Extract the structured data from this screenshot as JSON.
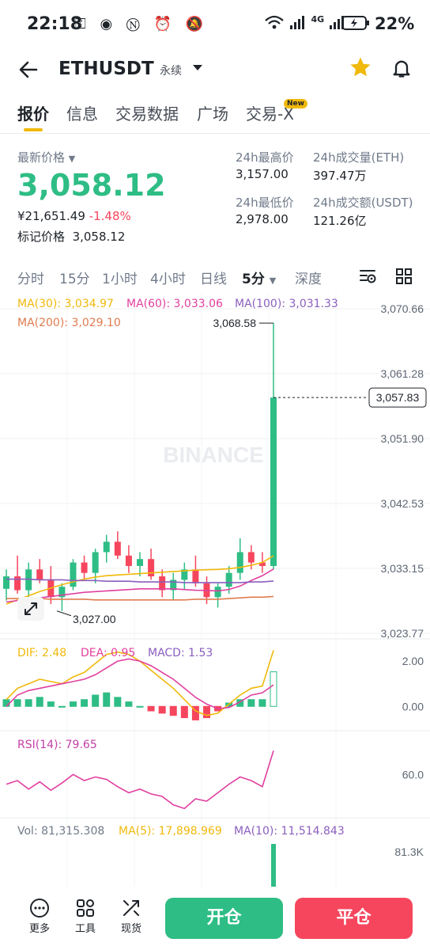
{
  "status_bar": {
    "time": "22:18",
    "icons": [
      "key-icon",
      "eye-icon",
      "nfc-icon",
      "alarm-icon",
      "mute-icon"
    ],
    "network": "4G",
    "wifi_tag": "6",
    "battery_pct": "22%"
  },
  "header": {
    "symbol": "ETHUSDT",
    "contract_type": "永续",
    "favorite": true
  },
  "tabs": [
    {
      "label": "报价",
      "active": true
    },
    {
      "label": "信息"
    },
    {
      "label": "交易数据"
    },
    {
      "label": "广场"
    },
    {
      "label": "交易-X",
      "badge": "New"
    }
  ],
  "price": {
    "last_label": "最新价格",
    "last": "3,058.12",
    "cny": "¥21,651.49",
    "change": "-1.48%",
    "mark_label": "标记价格",
    "mark": "3,058.12",
    "high_label": "24h最高价",
    "high": "3,157.00",
    "low_label": "24h最低价",
    "low": "2,978.00",
    "vol_label": "24h成交量(ETH)",
    "vol": "397.47万",
    "turnover_label": "24h成交额(USDT)",
    "turnover": "121.26亿"
  },
  "timeframes": [
    {
      "label": "分时"
    },
    {
      "label": "15分"
    },
    {
      "label": "1小时"
    },
    {
      "label": "4小时"
    },
    {
      "label": "日线"
    },
    {
      "label": "5分",
      "active": true
    },
    {
      "label": "深度"
    }
  ],
  "chart_data": {
    "type": "candlestick",
    "interval": "5分",
    "watermark": "BINANCE",
    "y_ticks": [
      "3,070.66",
      "3,061.28",
      "3,051.90",
      "3,042.53",
      "3,033.15",
      "3,023.77"
    ],
    "ylim": [
      3023.77,
      3070.66
    ],
    "current_price_tag": "3,057.83",
    "high_label": "3,068.58",
    "low_label": "3,027.00",
    "ma_legend": {
      "ma30": "MA(30): 3,034.97",
      "ma60": "MA(60): 3,033.06",
      "ma100": "MA(100): 3,031.33",
      "ma200": "MA(200): 3,029.10"
    },
    "colors": {
      "up": "#2ebd85",
      "down": "#f6465d",
      "ma30": "#f0b90b",
      "ma60": "#e0409f",
      "ma100": "#8b5fbf",
      "ma200": "#e07b4f"
    },
    "candles": [
      {
        "o": 3030.2,
        "h": 3033.0,
        "l": 3028.5,
        "c": 3032.0
      },
      {
        "o": 3032.0,
        "h": 3035.0,
        "l": 3029.5,
        "c": 3030.0
      },
      {
        "o": 3030.0,
        "h": 3034.0,
        "l": 3029.0,
        "c": 3033.0
      },
      {
        "o": 3033.0,
        "h": 3034.5,
        "l": 3031.0,
        "c": 3031.5
      },
      {
        "o": 3031.5,
        "h": 3033.5,
        "l": 3028.0,
        "c": 3029.0
      },
      {
        "o": 3029.0,
        "h": 3031.0,
        "l": 3027.0,
        "c": 3030.5
      },
      {
        "o": 3030.5,
        "h": 3034.5,
        "l": 3030.0,
        "c": 3034.0
      },
      {
        "o": 3034.0,
        "h": 3035.0,
        "l": 3031.5,
        "c": 3032.5
      },
      {
        "o": 3032.5,
        "h": 3036.0,
        "l": 3031.0,
        "c": 3035.5
      },
      {
        "o": 3035.5,
        "h": 3038.0,
        "l": 3034.0,
        "c": 3037.0
      },
      {
        "o": 3037.0,
        "h": 3038.5,
        "l": 3034.5,
        "c": 3035.0
      },
      {
        "o": 3035.0,
        "h": 3036.5,
        "l": 3032.5,
        "c": 3033.5
      },
      {
        "o": 3033.5,
        "h": 3035.5,
        "l": 3032.0,
        "c": 3034.5
      },
      {
        "o": 3034.5,
        "h": 3036.0,
        "l": 3031.5,
        "c": 3032.0
      },
      {
        "o": 3032.0,
        "h": 3033.0,
        "l": 3029.0,
        "c": 3030.0
      },
      {
        "o": 3030.0,
        "h": 3032.5,
        "l": 3028.5,
        "c": 3031.5
      },
      {
        "o": 3031.5,
        "h": 3034.0,
        "l": 3030.0,
        "c": 3033.0
      },
      {
        "o": 3033.0,
        "h": 3035.0,
        "l": 3030.5,
        "c": 3031.0
      },
      {
        "o": 3031.0,
        "h": 3032.0,
        "l": 3028.0,
        "c": 3029.0
      },
      {
        "o": 3029.0,
        "h": 3031.0,
        "l": 3027.5,
        "c": 3030.5
      },
      {
        "o": 3030.5,
        "h": 3033.5,
        "l": 3029.5,
        "c": 3032.5
      },
      {
        "o": 3032.5,
        "h": 3037.5,
        "l": 3031.5,
        "c": 3035.5
      },
      {
        "o": 3035.5,
        "h": 3036.5,
        "l": 3033.0,
        "c": 3034.0
      },
      {
        "o": 3034.0,
        "h": 3035.5,
        "l": 3032.5,
        "c": 3033.5
      },
      {
        "o": 3033.5,
        "h": 3068.58,
        "l": 3033.0,
        "c": 3057.83
      }
    ],
    "ma30": [
      3028.0,
      3028.6,
      3029.2,
      3029.8,
      3030.3,
      3030.8,
      3031.2,
      3031.6,
      3031.9,
      3032.1,
      3032.2,
      3032.3,
      3032.4,
      3032.5,
      3032.6,
      3032.7,
      3032.8,
      3032.9,
      3032.95,
      3033.0,
      3033.1,
      3033.3,
      3033.6,
      3034.0,
      3034.97
    ],
    "ma60": [
      3028.3,
      3028.5,
      3028.7,
      3028.9,
      3029.1,
      3029.3,
      3029.5,
      3029.7,
      3029.8,
      3029.9,
      3030.0,
      3030.1,
      3030.2,
      3030.2,
      3030.2,
      3030.2,
      3030.1,
      3030.0,
      3029.95,
      3029.9,
      3030.1,
      3030.6,
      3031.4,
      3032.1,
      3033.06
    ],
    "ma100": [
      3031.6,
      3031.6,
      3031.6,
      3031.5,
      3031.5,
      3031.5,
      3031.4,
      3031.4,
      3031.4,
      3031.3,
      3031.3,
      3031.3,
      3031.2,
      3031.2,
      3031.2,
      3031.2,
      3031.1,
      3031.1,
      3031.1,
      3031.1,
      3031.1,
      3031.1,
      3031.2,
      3031.2,
      3031.33
    ],
    "ma200": [
      3028.8,
      3028.8,
      3028.8,
      3028.8,
      3028.7,
      3028.7,
      3028.7,
      3028.7,
      3028.6,
      3028.6,
      3028.6,
      3028.6,
      3028.6,
      3028.6,
      3028.6,
      3028.6,
      3028.6,
      3028.7,
      3028.7,
      3028.7,
      3028.8,
      3028.9,
      3029.0,
      3029.0,
      3029.1
    ],
    "macd": {
      "dif_label": "DIF: 2.48",
      "dea_label": "DEA: 0.95",
      "macd_label": "MACD: 1.53",
      "y_ticks": [
        "2.00",
        "0.00"
      ],
      "ylim": [
        -0.9,
        2.6
      ],
      "dif": [
        0.3,
        0.8,
        1.0,
        1.2,
        1.1,
        1.0,
        1.3,
        1.5,
        1.9,
        2.3,
        2.4,
        2.3,
        2.0,
        1.6,
        1.2,
        0.8,
        0.3,
        -0.2,
        -0.4,
        -0.3,
        0.1,
        0.5,
        0.8,
        0.9,
        2.48
      ],
      "dea": [
        0.0,
        0.5,
        0.7,
        0.8,
        0.9,
        1.0,
        1.1,
        1.2,
        1.4,
        1.7,
        2.0,
        2.1,
        2.0,
        1.8,
        1.5,
        1.2,
        0.8,
        0.4,
        0.1,
        -0.1,
        -0.05,
        0.2,
        0.5,
        0.6,
        0.95
      ],
      "hist": [
        0.3,
        0.3,
        0.3,
        0.4,
        0.2,
        0.0,
        0.2,
        0.3,
        0.5,
        0.6,
        0.4,
        0.2,
        0.0,
        -0.2,
        -0.3,
        -0.4,
        -0.5,
        -0.6,
        -0.5,
        -0.2,
        0.15,
        0.3,
        0.3,
        0.3,
        1.53
      ]
    },
    "rsi": {
      "label": "RSI(14): 79.65",
      "y_ticks": [
        "60.0"
      ],
      "ylim": [
        25,
        85
      ],
      "values": [
        52,
        55,
        48,
        54,
        47,
        53,
        60,
        55,
        58,
        56,
        50,
        45,
        48,
        44,
        42,
        35,
        32,
        40,
        38,
        45,
        52,
        58,
        55,
        50,
        79.65
      ]
    },
    "volume": {
      "label": "Vol: 81,315.308",
      "ma5_label": "MA(5): 17,898.969",
      "ma10_label": "MA(10): 11,514.843",
      "y_tick": "81.3K",
      "last_value": 81315.308
    }
  },
  "bottom_bar": {
    "more": "更多",
    "tools": "工具",
    "spot": "现货",
    "open": "开仓",
    "close": "平仓"
  }
}
